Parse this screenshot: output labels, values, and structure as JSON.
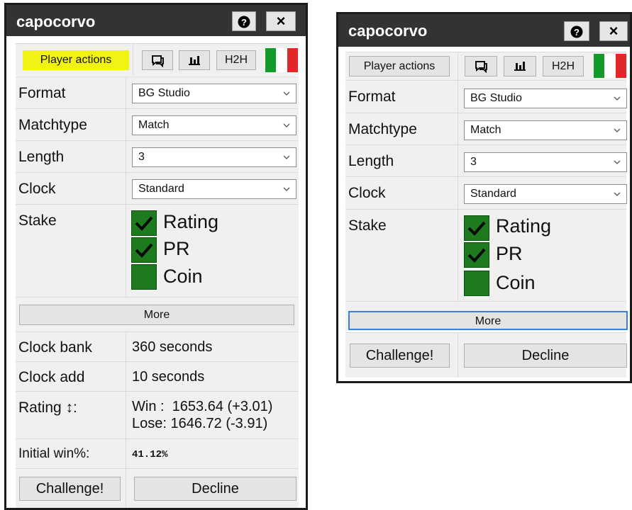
{
  "left_panel": {
    "title": "capocorvo",
    "help_icon": "?",
    "close_icon": "×",
    "player_actions_label": "Player actions",
    "h2h_label": "H2H",
    "format": {
      "label": "Format",
      "value": "BG Studio"
    },
    "matchtype": {
      "label": "Matchtype",
      "value": "Match"
    },
    "length": {
      "label": "Length",
      "value": "3"
    },
    "clock": {
      "label": "Clock",
      "value": "Standard"
    },
    "stake": {
      "label": "Stake",
      "options": [
        {
          "label": "Rating",
          "checked": true
        },
        {
          "label": "PR",
          "checked": true
        },
        {
          "label": "Coin",
          "checked": false
        }
      ]
    },
    "more_label": "More",
    "clock_bank": {
      "label": "Clock bank",
      "value": "360 seconds"
    },
    "clock_add": {
      "label": "Clock add",
      "value": "10 seconds"
    },
    "rating": {
      "label": "Rating ↕:",
      "win": "Win :  1653.64 (+3.01)",
      "lose": "Lose: 1646.72 (-3.91)"
    },
    "initial_win": {
      "label": "Initial win%:",
      "value": "41.12%"
    },
    "challenge_label": "Challenge!",
    "decline_label": "Decline"
  },
  "right_panel": {
    "title": "capocorvo",
    "help_icon": "?",
    "close_icon": "×",
    "player_actions_label": "Player actions",
    "h2h_label": "H2H",
    "format": {
      "label": "Format",
      "value": "BG Studio"
    },
    "matchtype": {
      "label": "Matchtype",
      "value": "Match"
    },
    "length": {
      "label": "Length",
      "value": "3"
    },
    "clock": {
      "label": "Clock",
      "value": "Standard"
    },
    "stake": {
      "label": "Stake",
      "options": [
        {
          "label": "Rating",
          "checked": true
        },
        {
          "label": "PR",
          "checked": true
        },
        {
          "label": "Coin",
          "checked": false
        }
      ]
    },
    "more_label": "More",
    "challenge_label": "Challenge!",
    "decline_label": "Decline"
  },
  "colors": {
    "titlebar": "#333333",
    "highlight": "#f2f215",
    "checkbox_green": "#1e7a1e",
    "flag_green": "#139a2b",
    "flag_white": "#ffffff",
    "flag_red": "#e3262a",
    "focus_border": "#3a7fd1"
  }
}
